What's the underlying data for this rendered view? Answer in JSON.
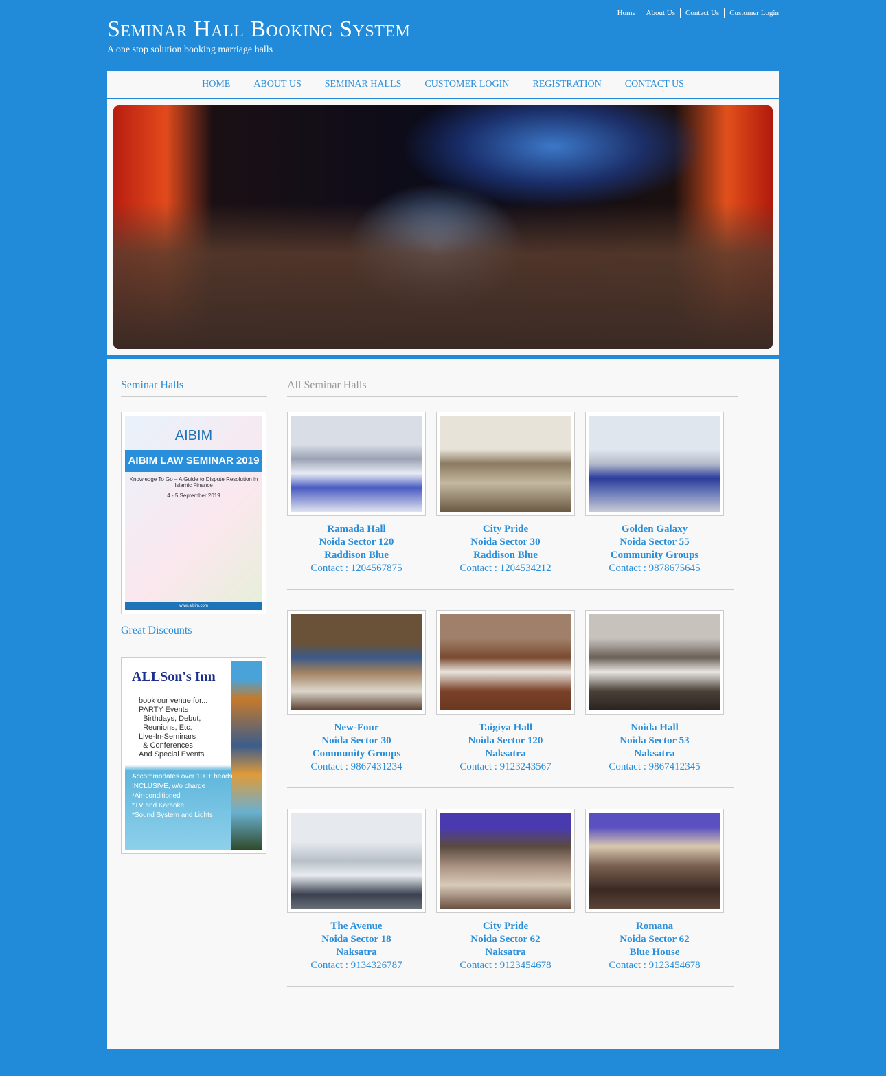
{
  "header": {
    "title": "Seminar Hall Booking System",
    "tagline": "A one stop solution booking marriage halls",
    "top_links": [
      "Home",
      "About Us",
      "Contact Us",
      "Customer Login"
    ]
  },
  "nav": [
    "HOME",
    "ABOUT US",
    "SEMINAR HALLS",
    "CUSTOMER LOGIN",
    "REGISTRATION",
    "CONTACT US"
  ],
  "sidebar": {
    "heading1": "Seminar Halls",
    "heading2": "Great Discounts",
    "poster": {
      "logo": "AIBIM",
      "title": "AIBIM LAW SEMINAR 2019",
      "subtitle": "Knowledge To Go – A Guide to Dispute Resolution in Islamic Finance",
      "date": "4 - 5 September 2019",
      "footer": "www.aibim.com"
    },
    "ad": {
      "title": "ALLSon's Inn",
      "body": "book our venue for...\nPARTY Events\n  Birthdays, Debut,\n  Reunions, Etc.\nLive-In-Seminars\n  & Conferences\nAnd Special Events",
      "features": "Accommodates over 100+ heads\nINCLUSIVE, w/o charge\n*Air-conditioned\n*TV and Karaoke\n*Sound System and Lights"
    }
  },
  "main": {
    "heading": "All Seminar Halls",
    "contact_prefix": "Contact : ",
    "halls": [
      {
        "name": "Ramada Hall",
        "location": "Noida Sector 120",
        "category": "Raddison Blue",
        "contact": "Contact : 1204567875"
      },
      {
        "name": "City Pride",
        "location": "Noida Sector 30",
        "category": "Raddison Blue",
        "contact": "Contact : 1204534212"
      },
      {
        "name": "Golden Galaxy",
        "location": "Noida Sector 55",
        "category": "Community Groups",
        "contact": "Contact : 9878675645"
      },
      {
        "name": "New-Four",
        "location": "Noida Sector 30",
        "category": "Community Groups",
        "contact": "Contact : 9867431234"
      },
      {
        "name": "Taigiya Hall",
        "location": "Noida Sector 120",
        "category": "Naksatra",
        "contact": "Contact : 9123243567"
      },
      {
        "name": "Noida Hall",
        "location": "Noida Sector 53",
        "category": "Naksatra",
        "contact": "Contact : 9867412345"
      },
      {
        "name": "The Avenue",
        "location": "Noida Sector 18",
        "category": "Naksatra",
        "contact": "Contact : 9134326787"
      },
      {
        "name": "City Pride",
        "location": "Noida Sector 62",
        "category": "Naksatra",
        "contact": "Contact : 9123454678"
      },
      {
        "name": "Romana",
        "location": "Noida Sector 62",
        "category": "Blue House",
        "contact": "Contact : 9123454678"
      }
    ]
  },
  "colors": {
    "background": "#218bd9",
    "link": "#2a8fdb",
    "panel": "#f8f8f8"
  }
}
